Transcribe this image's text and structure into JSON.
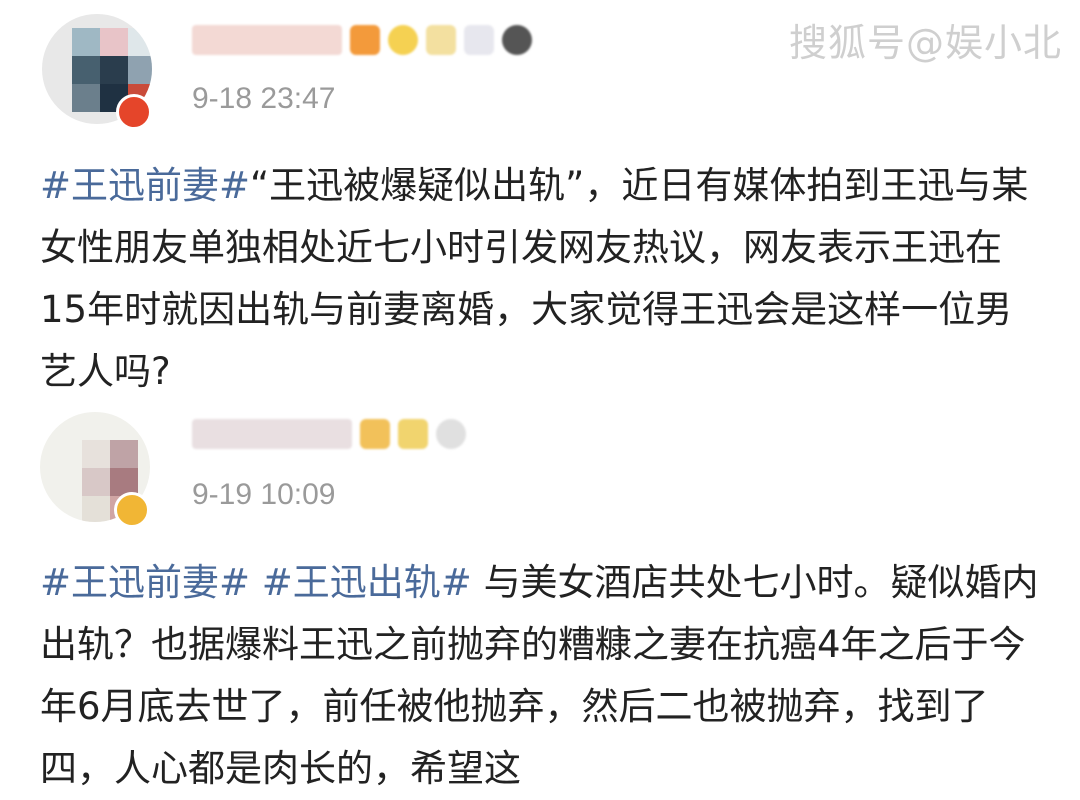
{
  "watermark": "搜狐号@娱小北",
  "posts": [
    {
      "time": "9-18 23:47",
      "topics": [
        "#王迅前妻#"
      ],
      "text": "“王迅被爆疑似出轨”，近日有媒体拍到王迅与某女性朋友单独相处近七小时引发网友热议，网友表示王迅在15年时就因出轨与前妻离婚，大家觉得王迅会是这样一位男艺人吗?"
    },
    {
      "time": "9-19 10:09",
      "topics": [
        "#王迅前妻#",
        "#王迅出轨#"
      ],
      "text": "与美女酒店共处七小时。疑似婚内出轨？也据爆料王迅之前抛弃的糟糠之妻在抗癌4年之后于今年6月底去世了，前任被他抛弃，然后二也被抛弃，找到了四，人心都是肉长的，希望这"
    }
  ],
  "colors": {
    "topic_link": "#4a6a9a",
    "timestamp": "#9a9a9a",
    "watermark": "#cfcfcf"
  }
}
